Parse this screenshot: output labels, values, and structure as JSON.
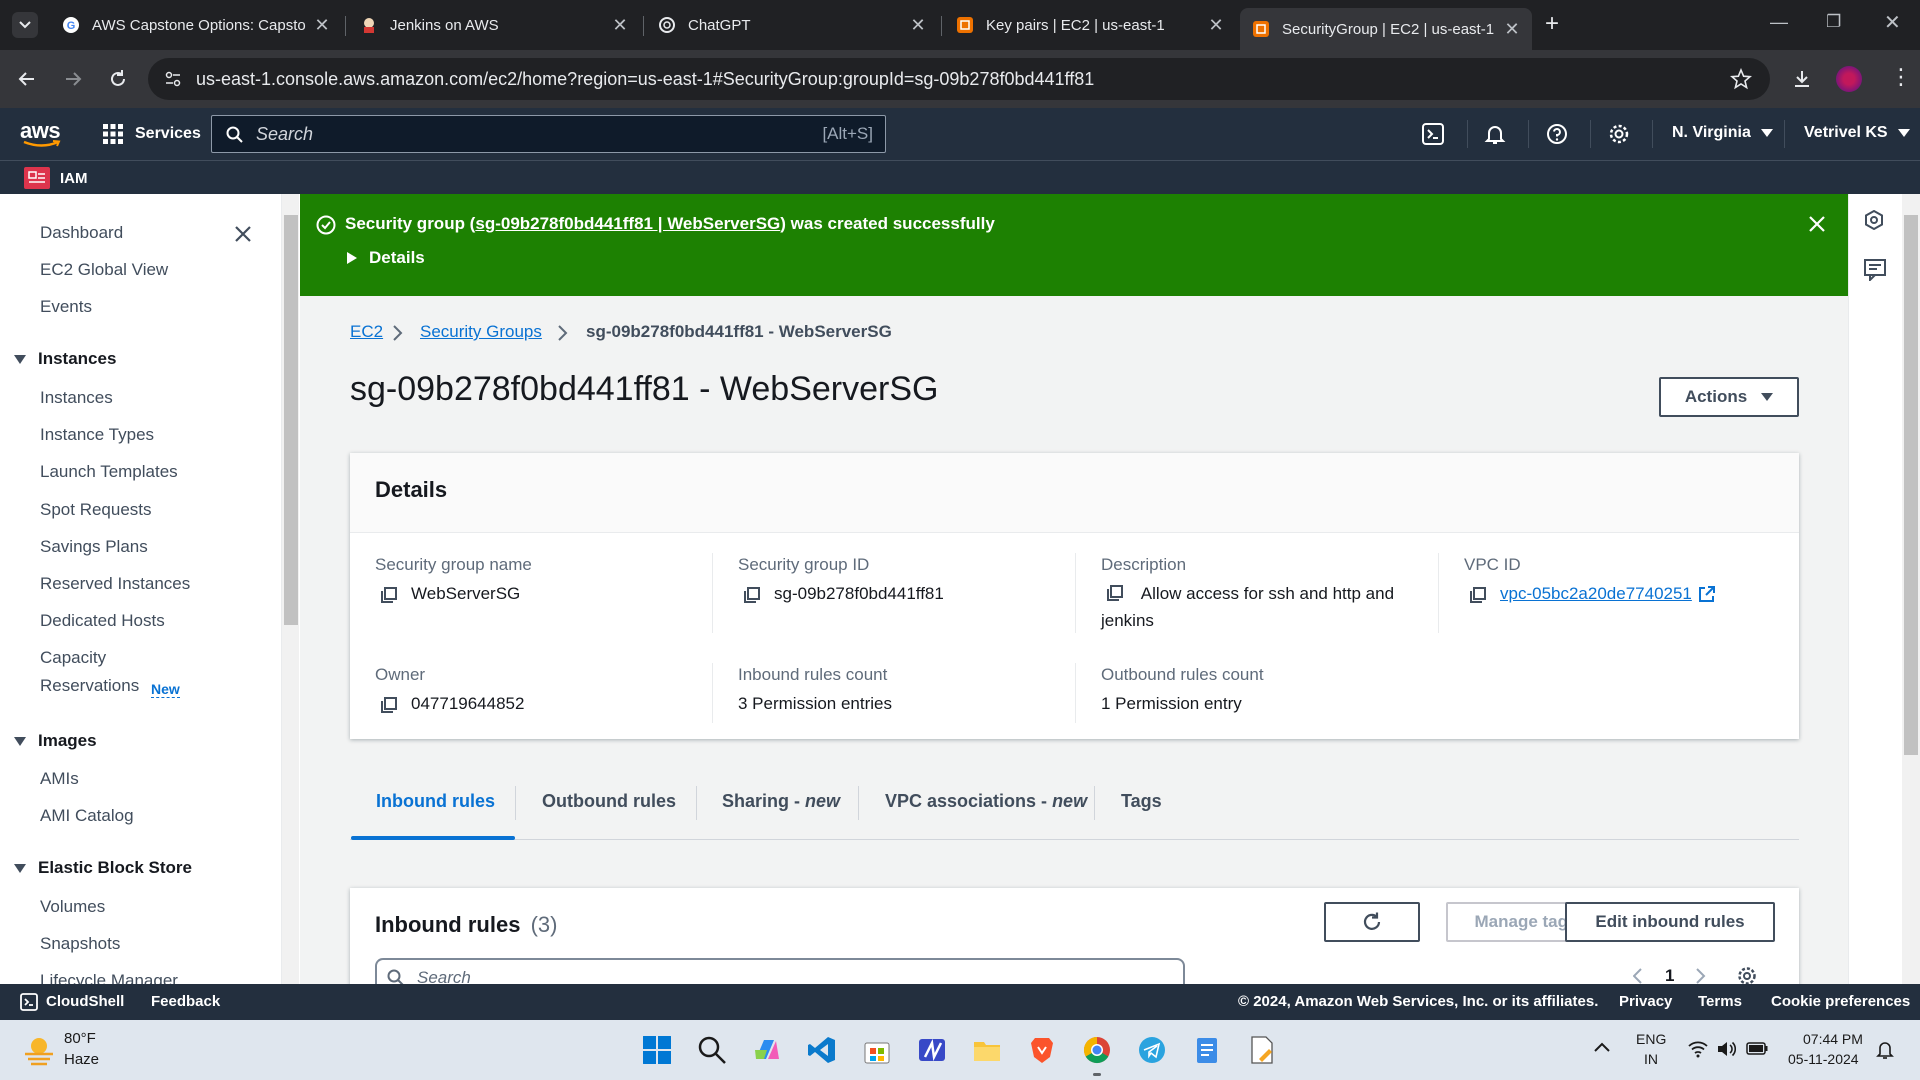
{
  "browser": {
    "tabs": [
      {
        "title": "AWS Capstone Options: Capsto",
        "active": false
      },
      {
        "title": "Jenkins on AWS",
        "active": false
      },
      {
        "title": "ChatGPT",
        "active": false
      },
      {
        "title": "Key pairs | EC2 | us-east-1",
        "active": false
      },
      {
        "title": "SecurityGroup | EC2 | us-east-1",
        "active": true
      }
    ],
    "new_tab": "+",
    "url": "us-east-1.console.aws.amazon.com/ec2/home?region=us-east-1#SecurityGroup:groupId=sg-09b278f0bd441ff81"
  },
  "aws_header": {
    "logo": "aws",
    "services": "Services",
    "search_placeholder": "Search",
    "search_shortcut": "[Alt+S]",
    "region": "N. Virginia",
    "user": "Vetrivel KS",
    "favorite": "IAM"
  },
  "sidebar": {
    "top_items": [
      "Dashboard",
      "EC2 Global View",
      "Events"
    ],
    "sections": [
      {
        "title": "Instances",
        "items": [
          "Instances",
          "Instance Types",
          "Launch Templates",
          "Spot Requests",
          "Savings Plans",
          "Reserved Instances",
          "Dedicated Hosts",
          "Capacity",
          "Reservations"
        ]
      },
      {
        "title": "Images",
        "items": [
          "AMIs",
          "AMI Catalog"
        ]
      },
      {
        "title": "Elastic Block Store",
        "items": [
          "Volumes",
          "Snapshots",
          "Lifecycle Manager"
        ]
      }
    ],
    "new_badge": "New"
  },
  "flash": {
    "prefix": "Security group (",
    "link": "sg-09b278f0bd441ff81 | WebServerSG",
    "suffix": ") was created successfully",
    "details": "Details",
    "color": "#1d8102"
  },
  "breadcrumb": {
    "ec2": "EC2",
    "security_groups": "Security Groups",
    "current": "sg-09b278f0bd441ff81 - WebServerSG"
  },
  "page_title": "sg-09b278f0bd441ff81 - WebServerSG",
  "actions_label": "Actions",
  "details": {
    "heading": "Details",
    "sg_name_label": "Security group name",
    "sg_name": "WebServerSG",
    "sg_id_label": "Security group ID",
    "sg_id": "sg-09b278f0bd441ff81",
    "description_label": "Description",
    "description": "Allow access for ssh and http and jenkins",
    "vpc_label": "VPC ID",
    "vpc_id": "vpc-05bc2a20de7740251",
    "owner_label": "Owner",
    "owner": "047719644852",
    "inbound_label": "Inbound rules count",
    "inbound": "3 Permission entries",
    "outbound_label": "Outbound rules count",
    "outbound": "1 Permission entry"
  },
  "tabs": {
    "inbound": "Inbound rules",
    "outbound": "Outbound rules",
    "sharing": "Sharing - ",
    "vpc_assoc": "VPC associations - ",
    "new_suffix": "new",
    "tags": "Tags"
  },
  "inbound_panel": {
    "title": "Inbound rules",
    "count": "(3)",
    "manage_tags": "Manage tags",
    "edit": "Edit inbound rules",
    "search_placeholder": "Search",
    "page": "1"
  },
  "footer": {
    "cloudshell": "CloudShell",
    "feedback": "Feedback",
    "copyright": "© 2024, Amazon Web Services, Inc. or its affiliates.",
    "privacy": "Privacy",
    "terms": "Terms",
    "cookie": "Cookie preferences"
  },
  "taskbar": {
    "temp": "80°F",
    "weather": "Haze",
    "lang": "ENG",
    "region": "IN",
    "time": "07:44 PM",
    "date": "05-11-2024"
  },
  "colors": {
    "aws_nav": "#232f3e",
    "link": "#0972d3",
    "active_tab": "#0972d3",
    "success": "#1d8102"
  }
}
